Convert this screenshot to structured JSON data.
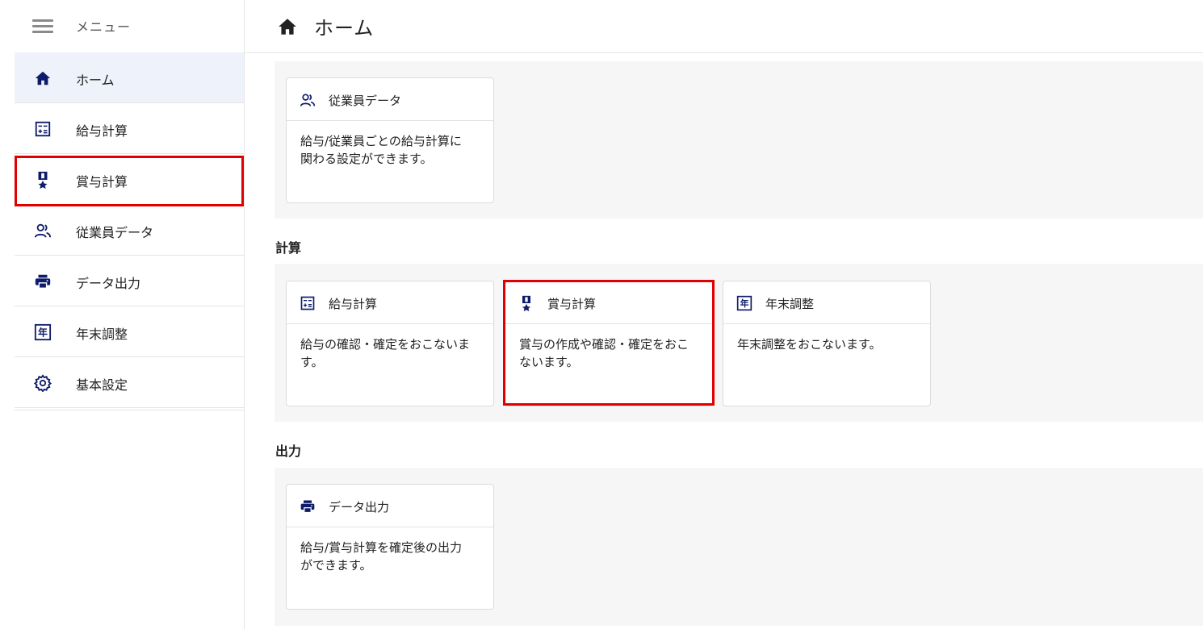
{
  "sidebar": {
    "menu_label": "メニュー",
    "items": [
      {
        "label": "ホーム",
        "icon": "home-icon",
        "active": true
      },
      {
        "label": "給与計算",
        "icon": "calculator-icon"
      },
      {
        "label": "賞与計算",
        "icon": "medal-icon"
      },
      {
        "label": "従業員データ",
        "icon": "people-icon"
      },
      {
        "label": "データ出力",
        "icon": "printer-icon"
      },
      {
        "label": "年末調整",
        "icon": "year-icon"
      },
      {
        "label": "基本設定",
        "icon": "gear-icon"
      }
    ]
  },
  "header": {
    "title": "ホーム"
  },
  "sections": {
    "settings_cards": [
      {
        "title": "従業員データ",
        "body": "給与/従業員ごとの給与計算に\n関わる設定ができます。"
      }
    ],
    "calc": {
      "title": "計算",
      "cards": [
        {
          "title": "給与計算",
          "body": "給与の確認・確定をおこないま\nす。"
        },
        {
          "title": "賞与計算",
          "body": "賞与の作成や確認・確定をおこ\nないます。"
        },
        {
          "title": "年末調整",
          "body": "年末調整をおこないます。"
        }
      ]
    },
    "output": {
      "title": "出力",
      "cards": [
        {
          "title": "データ出力",
          "body": "給与/賞与計算を確定後の出力\nができます。"
        }
      ]
    }
  },
  "colors": {
    "icon": "#0e1b6b",
    "highlight": "#e00000",
    "active_bg": "#eef2fb"
  }
}
